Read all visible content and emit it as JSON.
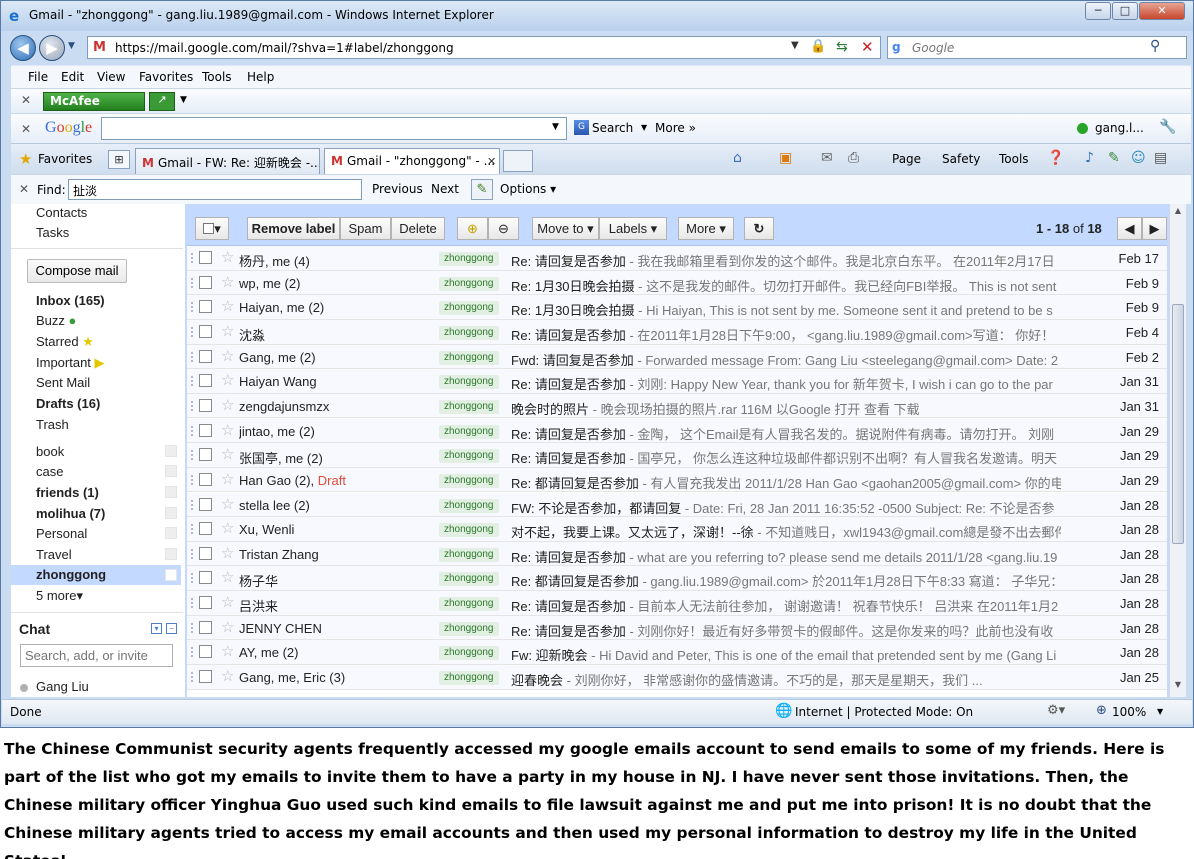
{
  "window": {
    "title": "Gmail - \"zhonggong\" - gang.liu.1989@gmail.com - Windows Internet Explorer",
    "min": "─",
    "max": "□",
    "close": "✕"
  },
  "address": {
    "url": "https://mail.google.com/mail/?shva=1#label/zhonggong",
    "search_placeholder": "Google"
  },
  "menu": [
    "File",
    "Edit",
    "View",
    "Favorites",
    "Tools",
    "Help"
  ],
  "mcafee": {
    "label": "McAfee"
  },
  "google_toolbar": {
    "logo": "Google",
    "search": "Search",
    "more": "More »",
    "user": "gang.l..."
  },
  "tabs": {
    "favorites": "Favorites",
    "tab1": "Gmail - FW: Re: 迎新晚会 -...",
    "tab2": "Gmail - \"zhonggong\" - ...",
    "commands": {
      "page": "Page",
      "safety": "Safety",
      "tools": "Tools"
    }
  },
  "find": {
    "label": "Find:",
    "value": "扯淡",
    "previous": "Previous",
    "next": "Next",
    "options": "Options"
  },
  "sidebar": {
    "top": [
      "Contacts",
      "Tasks"
    ],
    "compose": "Compose mail",
    "inbox": "Inbox (165)",
    "buzz": "Buzz",
    "starred": "Starred",
    "important": "Important",
    "sent": "Sent Mail",
    "drafts": "Drafts (16)",
    "trash": "Trash",
    "labels": [
      "book",
      "case",
      "friends (1)",
      "molihua (7)",
      "Personal",
      "Travel"
    ],
    "selected_label": "zhonggong",
    "more": "5 more▾",
    "chat_title": "Chat",
    "chat_search_placeholder": "Search, add, or invite",
    "chat_user": "Gang Liu"
  },
  "toolbar": {
    "select": "▾",
    "remove_label": "Remove label",
    "spam": "Spam",
    "delete": "Delete",
    "move_to": "Move to ▾",
    "labels": "Labels ▾",
    "more": "More ▾",
    "refresh": "↻",
    "count_range": "1 - 18",
    "count_of": " of ",
    "count_total": "18"
  },
  "label_tag": "zhonggong",
  "emails": [
    {
      "from": "杨丹, me (4)",
      "draft": "",
      "subject": "Re: 请回复是否参加",
      "snippet": " - 我在我邮箱里看到你发的这个邮件。我是北京白东平。 在2011年2月17日",
      "date": "Feb 17"
    },
    {
      "from": "wp, me (2)",
      "draft": "",
      "subject": "Re: 1月30日晚会拍摄",
      "snippet": " - 这不是我发的邮件。切勿打开邮件。我已经向FBI举报。 This is not sent",
      "date": "Feb 9"
    },
    {
      "from": "Haiyan, me (2)",
      "draft": "",
      "subject": "Re: 1月30日晚会拍摄",
      "snippet": " - Hi Haiyan, This is not sent by me. Someone sent it and pretend to be s",
      "date": "Feb 9"
    },
    {
      "from": "沈淼",
      "draft": "",
      "subject": "Re: 请回复是否参加",
      "snippet": " - 在2011年1月28日下午9:00， <gang.liu.1989@gmail.com>写道： 你好！",
      "date": "Feb 4"
    },
    {
      "from": "Gang, me (2)",
      "draft": "",
      "subject": "Fwd: 请回复是否参加",
      "snippet": " - Forwarded message From: Gang Liu <steelegang@gmail.com> Date: 2",
      "date": "Feb 2"
    },
    {
      "from": "Haiyan Wang",
      "draft": "",
      "subject": "Re: 请回复是否参加",
      "snippet": " - 刘刚: Happy New Year, thank you for 新年贺卡, I wish i can go to the par",
      "date": "Jan 31"
    },
    {
      "from": "zengdajunsmzx",
      "draft": "",
      "subject": "晚会时的照片",
      "snippet": " - 晚会现场拍摄的照片.rar 116M 以Google 打开 查看 下载",
      "date": "Jan 31"
    },
    {
      "from": "jintao, me (2)",
      "draft": "",
      "subject": "Re: 请回复是否参加",
      "snippet": " - 金陶， 这个Email是有人冒我名发的。据说附件有病毒。请勿打开。 刘刚",
      "date": "Jan 29"
    },
    {
      "from": "张国亭, me (2)",
      "draft": "",
      "subject": "Re: 请回复是否参加",
      "snippet": " - 国亭兄， 你怎么连这种垃圾邮件都识别不出啊？有人冒我名发邀请。明天",
      "date": "Jan 29"
    },
    {
      "from": "Han Gao (2), ",
      "draft": "Draft",
      "subject": "Re: 都请回复是否参加",
      "snippet": " - 有人冒充我发出 2011/1/28 Han Gao <gaohan2005@gmail.com> 你的电",
      "date": "Jan 29"
    },
    {
      "from": "stella lee (2)",
      "draft": "",
      "subject": "FW: 不论是否参加，都请回复",
      "snippet": " - Date: Fri, 28 Jan 2011 16:35:52 -0500 Subject: Re: 不论是否参",
      "date": "Jan 28"
    },
    {
      "from": "Xu, Wenli",
      "draft": "",
      "subject": "对不起，我要上课。又太远了，深谢！--徐",
      "snippet": " - 不知道贱日，xwl1943@gmail.com總是發不出去郵件",
      "date": "Jan 28"
    },
    {
      "from": "Tristan Zhang",
      "draft": "",
      "subject": "Re: 请回复是否参加",
      "snippet": " - what are you referring to? please send me details 2011/1/28 <gang.liu.19",
      "date": "Jan 28"
    },
    {
      "from": "杨子华",
      "draft": "",
      "subject": "Re: 都请回复是否参加",
      "snippet": " - gang.liu.1989@gmail.com> 於2011年1月28日下午8:33 寫道： 子华兄：",
      "date": "Jan 28"
    },
    {
      "from": "吕洪来",
      "draft": "",
      "subject": "Re: 请回复是否参加",
      "snippet": " - 目前本人无法前往参加， 谢谢邀请！ 祝春节快乐！ 吕洪来 在2011年1月2",
      "date": "Jan 28"
    },
    {
      "from": "JENNY CHEN",
      "draft": "",
      "subject": "Re: 请回复是否参加",
      "snippet": " - 刘刚你好！最近有好多带贺卡的假邮件。这是你发来的吗？此前也没有收",
      "date": "Jan 28"
    },
    {
      "from": "AY, me (2)",
      "draft": "",
      "subject": "Fw: 迎新晚会",
      "snippet": " - Hi David and Peter, This is one of the email that pretended sent by me (Gang Li",
      "date": "Jan 28"
    },
    {
      "from": "Gang, me, Eric (3)",
      "draft": "",
      "subject": "迎春晚会",
      "snippet": " - 刘刚你好， 非常感谢你的盛情邀请。不巧的是，那天是星期天，我们 ...",
      "date": "Jan 25"
    }
  ],
  "status": {
    "left": "Done",
    "zone": "Internet | Protected Mode: On",
    "zoom": "100%"
  },
  "caption": "The Chinese Communist security agents frequently accessed my google emails account to send emails to some of my friends. Here is part of the list who got my emails to invite them to have a party in my house in NJ. I have never sent those invitations. Then, the Chinese military officer Yinghua Guo used such kind emails to file lawsuit against me and put me into prison! It is no doubt that the Chinese military agents tried to access my email accounts and then used my personal information to destroy my life in the United States!"
}
